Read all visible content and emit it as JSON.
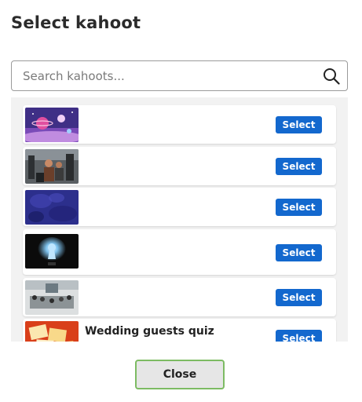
{
  "dialog": {
    "title": "Select kahoot",
    "search_placeholder": "Search kahoots...",
    "close_label": "Close"
  },
  "kahoots": [
    {
      "title": "",
      "select_label": "Select",
      "thumbnail": "space-planets-thumbnail"
    },
    {
      "title": "",
      "select_label": "Select",
      "thumbnail": "office-people-thumbnail"
    },
    {
      "title": "",
      "select_label": "Select",
      "thumbnail": "purple-texture-thumbnail"
    },
    {
      "title": "",
      "select_label": "Select",
      "thumbnail": "keyhole-light-thumbnail"
    },
    {
      "title": "",
      "select_label": "Select",
      "thumbnail": "conference-room-thumbnail"
    },
    {
      "title": "Wedding guests quiz",
      "select_label": "Select",
      "thumbnail": "wedding-cards-thumbnail"
    }
  ],
  "colors": {
    "select_button": "#1368ce",
    "close_border": "#7dbb63",
    "list_background": "#f2f2f2"
  }
}
